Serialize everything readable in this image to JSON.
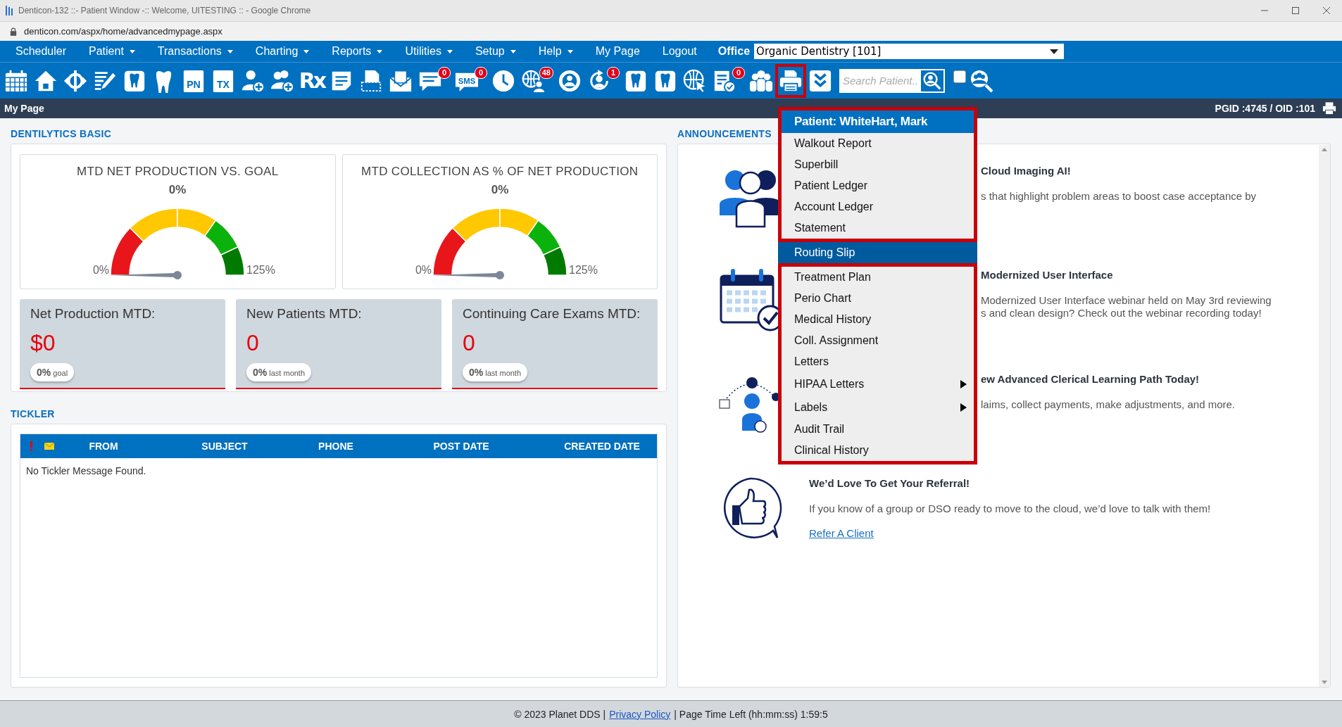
{
  "window": {
    "title": "Denticon-132 ::- Patient Window -:: Welcome, UITESTING :: - Google Chrome"
  },
  "address_bar": {
    "url": "denticon.com/aspx/home/advancedmypage.aspx"
  },
  "menu_bar": {
    "items": [
      {
        "label": "Scheduler",
        "dropdown": false
      },
      {
        "label": "Patient",
        "dropdown": true
      },
      {
        "label": "Transactions",
        "dropdown": true
      },
      {
        "label": "Charting",
        "dropdown": true
      },
      {
        "label": "Reports",
        "dropdown": true
      },
      {
        "label": "Utilities",
        "dropdown": true
      },
      {
        "label": "Setup",
        "dropdown": true
      },
      {
        "label": "Help",
        "dropdown": true
      },
      {
        "label": "My Page",
        "dropdown": false
      },
      {
        "label": "Logout",
        "dropdown": false
      }
    ],
    "office_label": "Office",
    "office_select": "Organic Dentistry [101]"
  },
  "toolbar": {
    "icons": [
      {
        "kind": "calendar",
        "highlighted": false
      },
      {
        "kind": "home",
        "highlighted": false
      },
      {
        "kind": "coin",
        "highlighted": false
      },
      {
        "kind": "edit",
        "highlighted": false
      },
      {
        "kind": "tooth-box",
        "highlighted": false
      },
      {
        "kind": "tooth",
        "highlighted": false
      },
      {
        "kind": "doc-text",
        "text": "PN",
        "highlighted": false
      },
      {
        "kind": "doc-text",
        "text": "TX",
        "highlighted": false
      },
      {
        "kind": "person-add",
        "highlighted": false
      },
      {
        "kind": "people-add",
        "highlighted": false
      },
      {
        "kind": "rx",
        "text": "Rx",
        "highlighted": false
      },
      {
        "kind": "note",
        "highlighted": false
      },
      {
        "kind": "scanner",
        "highlighted": false
      },
      {
        "kind": "envelope",
        "highlighted": false
      },
      {
        "kind": "chat",
        "badge": "0",
        "highlighted": false
      },
      {
        "kind": "sms",
        "text": "SMS",
        "badge": "0",
        "highlighted": false
      },
      {
        "kind": "clock",
        "highlighted": false
      },
      {
        "kind": "globe-person",
        "badge": "48",
        "highlighted": false
      },
      {
        "kind": "globe-user",
        "highlighted": false
      },
      {
        "kind": "person-refresh",
        "badge": "1",
        "highlighted": false
      },
      {
        "kind": "tooth-box",
        "highlighted": false
      },
      {
        "kind": "tooth-box",
        "highlighted": false
      },
      {
        "kind": "globe-cursor",
        "highlighted": false
      },
      {
        "kind": "doc-check",
        "badge": "0",
        "highlighted": false
      },
      {
        "kind": "people",
        "highlighted": false
      },
      {
        "kind": "printer",
        "highlighted": true
      },
      {
        "kind": "chevrons",
        "highlighted": false
      }
    ],
    "search": {
      "placeholder": "Search Patient..."
    },
    "checkbox": {
      "checked": false
    }
  },
  "page_bar": {
    "title": "My Page",
    "ids": "PGID :4745 / OID :101"
  },
  "dentilytics": {
    "heading": "DENTILYTICS BASIC",
    "gauges": [
      {
        "title": "MTD NET PRODUCTION VS. GOAL",
        "value": "0%",
        "min_label": "0%",
        "max_label": "125%"
      },
      {
        "title": "MTD COLLECTION AS % OF NET PRODUCTION",
        "value": "0%",
        "min_label": "0%",
        "max_label": "125%"
      }
    ],
    "stats": [
      {
        "title": "Net Production MTD:",
        "value": "$0",
        "badge": "**0%** goal"
      },
      {
        "title": "New Patients MTD:",
        "value": "0",
        "badge": "**0%** last month"
      },
      {
        "title": "Continuing Care Exams MTD:",
        "value": "0",
        "badge": "**0%** last month"
      }
    ]
  },
  "tickler": {
    "heading": "TICKLER",
    "columns": [
      "FROM",
      "SUBJECT",
      "PHONE",
      "POST DATE",
      "CREATED DATE"
    ],
    "empty_message": "No Tickler Message Found."
  },
  "announcements": {
    "heading": "ANNOUNCEMENTS",
    "items": [
      {
        "kind": "people",
        "title": "Cloud Imaging AI!",
        "lines": [
          "s that highlight problem areas to boost case acceptance by"
        ],
        "partly_hidden": true
      },
      {
        "kind": "calendar",
        "title": "Modernized User Interface",
        "lines": [
          "Modernized User Interface webinar held on May 3rd reviewing",
          "s and clean design? Check out the webinar recording today!"
        ],
        "partly_hidden": true
      },
      {
        "kind": "learner",
        "title": "ew Advanced Clerical Learning Path Today!",
        "lines": [
          "laims, collect payments, make adjustments, and more."
        ],
        "partly_hidden": true
      },
      {
        "kind": "thumbs-up",
        "title": "We’d Love To Get Your Referral!",
        "lines": [
          "If you know of a group or DSO ready to move to the cloud, we’d love to talk with them!"
        ],
        "link": "Refer A Client"
      }
    ]
  },
  "patient_menu": {
    "header": "Patient: WhiteHart, Mark",
    "items": [
      {
        "label": "Walkout Report",
        "selected": false,
        "submenu": false
      },
      {
        "label": "Superbill",
        "selected": false,
        "submenu": false
      },
      {
        "label": "Patient Ledger",
        "selected": false,
        "submenu": false
      },
      {
        "label": "Account Ledger",
        "selected": false,
        "submenu": false
      },
      {
        "label": "Statement",
        "selected": false,
        "submenu": false
      },
      {
        "label": "Routing Slip",
        "selected": true,
        "submenu": false
      },
      {
        "label": "Treatment Plan",
        "selected": false,
        "submenu": false
      },
      {
        "label": "Perio Chart",
        "selected": false,
        "submenu": false
      },
      {
        "label": "Medical History",
        "selected": false,
        "submenu": false
      },
      {
        "label": "Coll. Assignment",
        "selected": false,
        "submenu": false
      },
      {
        "label": "Letters",
        "selected": false,
        "submenu": false
      },
      {
        "label": "HIPAA Letters",
        "selected": false,
        "submenu": true
      },
      {
        "label": "Labels",
        "selected": false,
        "submenu": true
      },
      {
        "label": "Audit Trail",
        "selected": false,
        "submenu": false
      },
      {
        "label": "Clinical History",
        "selected": false,
        "submenu": false
      }
    ]
  },
  "footer": {
    "copyright": "© 2023 Planet DDS |",
    "link": "Privacy Policy",
    "time": "| Page Time Left (hh:mm:ss) 1:59:5"
  }
}
